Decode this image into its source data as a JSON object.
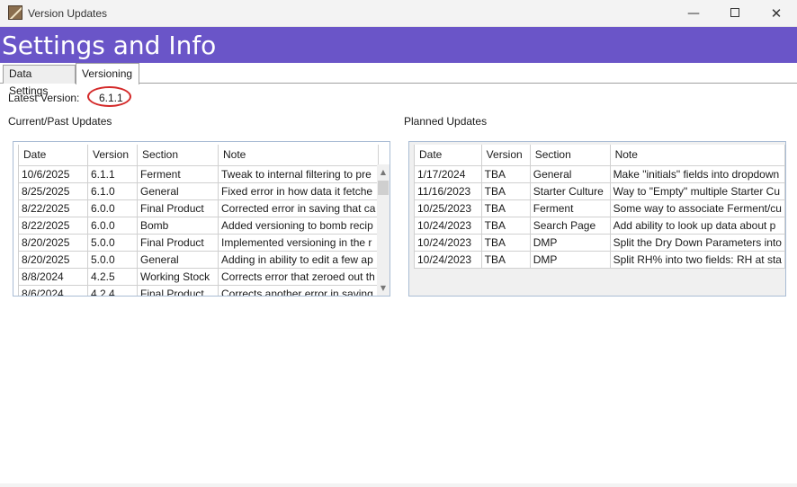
{
  "window": {
    "title": "Version Updates",
    "minimize_glyph": "—",
    "close_glyph": "✕"
  },
  "header": {
    "title": "Settings and Info",
    "color": "#6a55c8"
  },
  "tabs": [
    {
      "label": "Data Settings",
      "selected": false
    },
    {
      "label": "Versioning",
      "selected": true
    }
  ],
  "latest": {
    "label": "Latest Version:",
    "value": "6.1.1",
    "annotation_color": "#d42a2a"
  },
  "current": {
    "label": "Current/Past Updates",
    "columns": [
      "Date",
      "Version",
      "Section",
      "Note"
    ],
    "rows": [
      [
        "10/6/2025",
        "6.1.1",
        "Ferment",
        "Tweak to internal filtering to pre"
      ],
      [
        "8/25/2025",
        "6.1.0",
        "General",
        "Fixed error in how data it fetche"
      ],
      [
        "8/22/2025",
        "6.0.0",
        "Final Product",
        "Corrected error in saving that ca"
      ],
      [
        "8/22/2025",
        "6.0.0",
        "Bomb",
        "Added versioning to bomb recip"
      ],
      [
        "8/20/2025",
        "5.0.0",
        "Final Product",
        "Implemented versioning in the r"
      ],
      [
        "8/20/2025",
        "5.0.0",
        "General",
        "Adding in ability to edit a few ap"
      ],
      [
        "8/8/2024",
        "4.2.5",
        "Working Stock",
        "Corrects error that zeroed out th"
      ],
      [
        "8/6/2024",
        "4.2.4",
        "Final Product",
        "Corrects another error in saving"
      ]
    ],
    "scroll_up_glyph": "▲",
    "scroll_down_glyph": "▼"
  },
  "planned": {
    "label": "Planned Updates",
    "columns": [
      "Date",
      "Version",
      "Section",
      "Note"
    ],
    "rows": [
      [
        "1/17/2024",
        "TBA",
        "General",
        "Make \"initials\" fields into dropdown"
      ],
      [
        "11/16/2023",
        "TBA",
        "Starter Culture",
        "Way to \"Empty\" multiple Starter Cu"
      ],
      [
        "10/25/2023",
        "TBA",
        "Ferment",
        "Some way to associate Ferment/cu"
      ],
      [
        "10/24/2023",
        "TBA",
        "Search Page",
        "Add ability to look up data about p"
      ],
      [
        "10/24/2023",
        "TBA",
        "DMP",
        "Split the Dry Down Parameters into"
      ],
      [
        "10/24/2023",
        "TBA",
        "DMP",
        "Split RH% into two fields: RH at sta"
      ]
    ]
  }
}
